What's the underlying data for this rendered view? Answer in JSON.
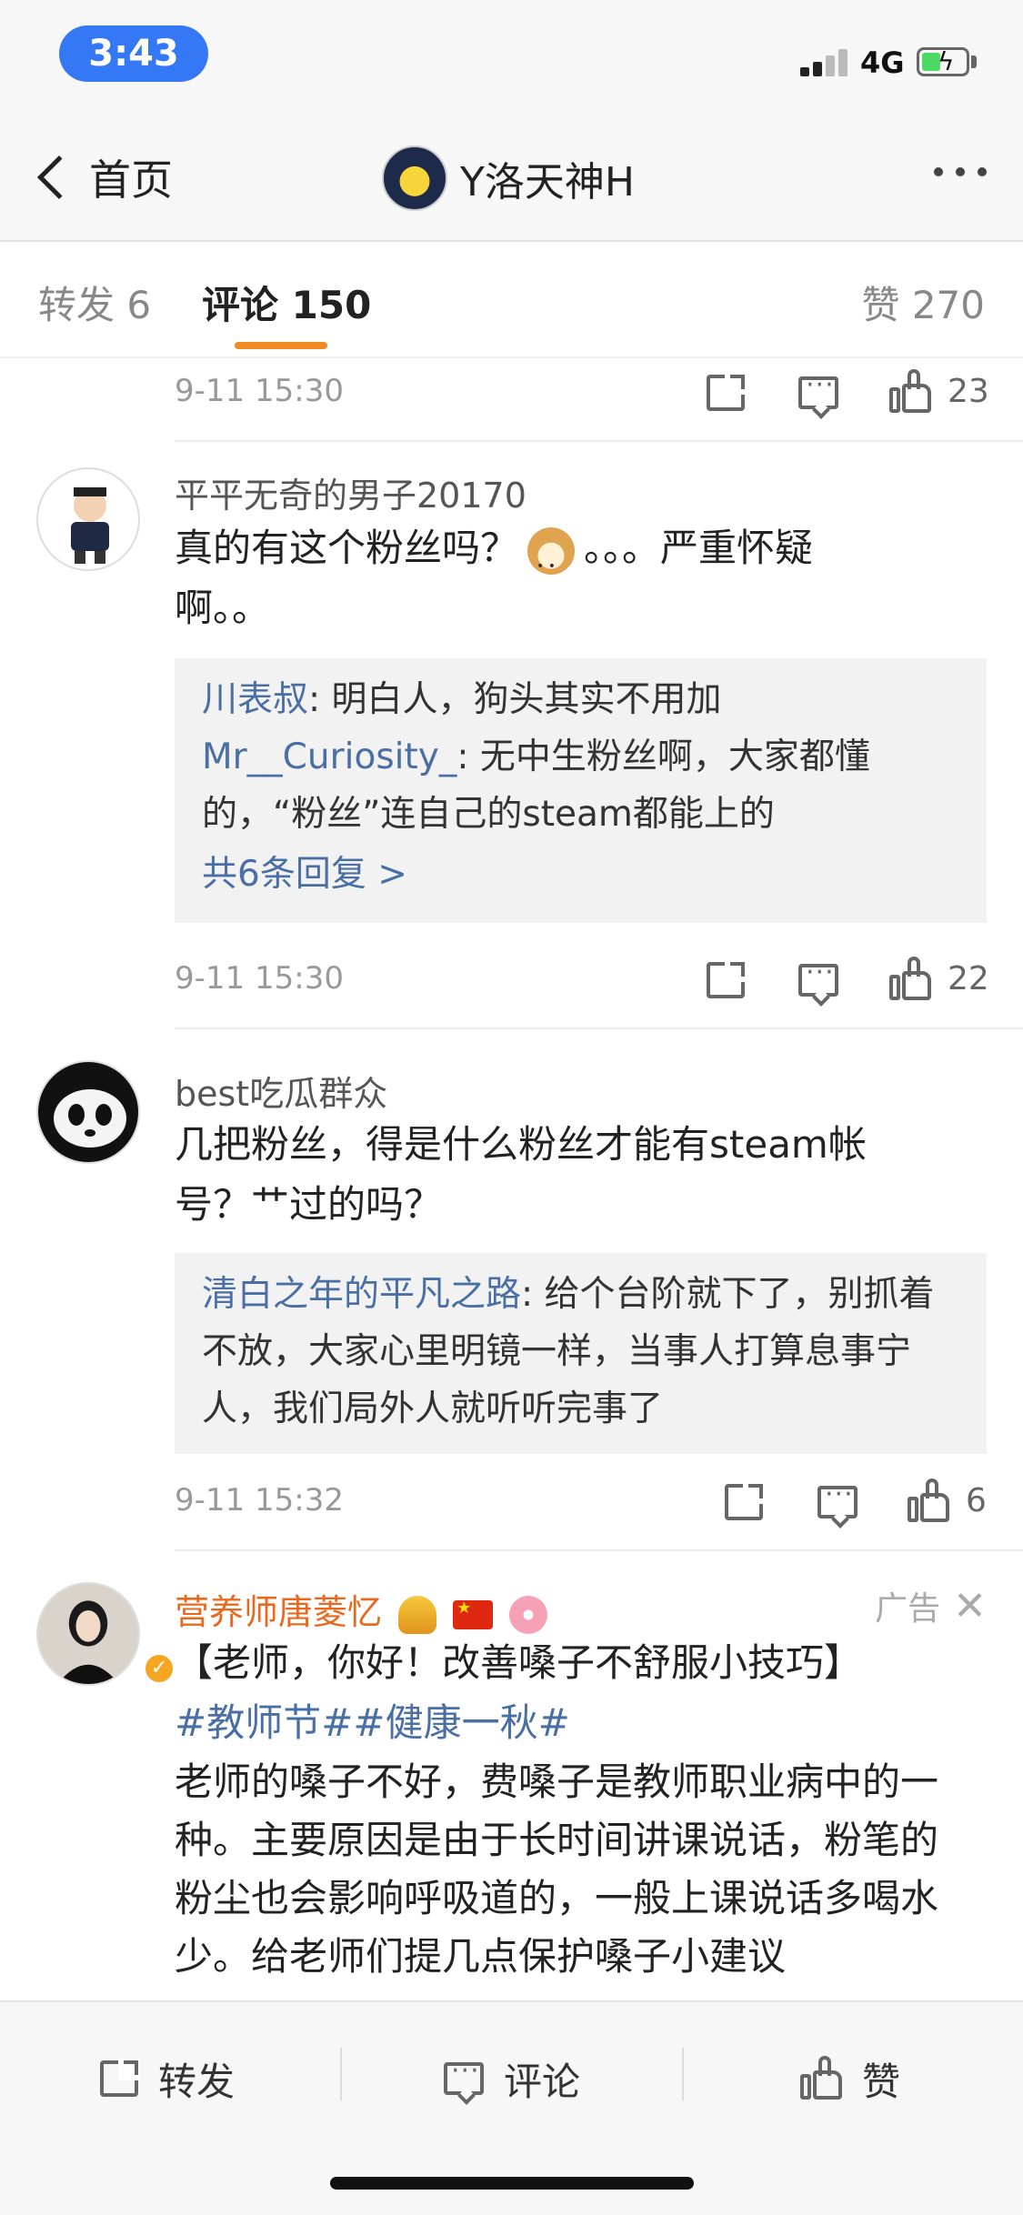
{
  "status_bar": {
    "time": "3:43",
    "network": "4G"
  },
  "nav": {
    "back_label": "首页",
    "title": "Y洛天神H"
  },
  "tabs": {
    "repost": "转发 6",
    "comments": "评论 150",
    "likes": "赞 270"
  },
  "feed": {
    "top_row": {
      "time": "9-11 15:30",
      "likes": "23"
    },
    "comments": [
      {
        "username": "平平无奇的男子20170",
        "text_part1": "真的有这个粉丝吗？",
        "text_part2": "。。。严重怀疑",
        "text_line2": "啊。。",
        "replies": [
          {
            "user": "川表叔",
            "text": ": 明白人，狗头其实不用加"
          },
          {
            "user": "Mr__Curiosity_",
            "text": ": 无中生粉丝啊，大家都懂的，“粉丝”连自己的steam都能上的"
          }
        ],
        "more_replies": "共6条回复 >",
        "time": "9-11 15:30",
        "likes": "22"
      },
      {
        "username": "best吃瓜群众",
        "text_line1": "几把粉丝，得是什么粉丝才能有steam帐",
        "text_line2": "号？艹过的吗？",
        "replies": [
          {
            "user": "清白之年的平凡之路",
            "text": ": 给个台阶就下了，别抓着不放，大家心里明镜一样，当事人打算息事宁人，我们局外人就听听完事了"
          }
        ],
        "time": "9-11 15:32",
        "likes": "6"
      }
    ],
    "ad": {
      "username": "营养师唐菱忆",
      "ad_label": "广告",
      "headline": "【老师，你好！改善嗓子不舒服小技巧】",
      "hashtags": "#教师节##健康一秋#",
      "body": "老师的嗓子不好，费嗓子是教师职业病中的一种。主要原因是由于长时间讲课说话，粉笔的粉尘也会影响呼吸道的，一般上课说话多喝水少。给老师们提几点保护嗓子小建议"
    }
  },
  "bottom_bar": {
    "repost": "转发",
    "comment": "评论",
    "like": "赞"
  }
}
